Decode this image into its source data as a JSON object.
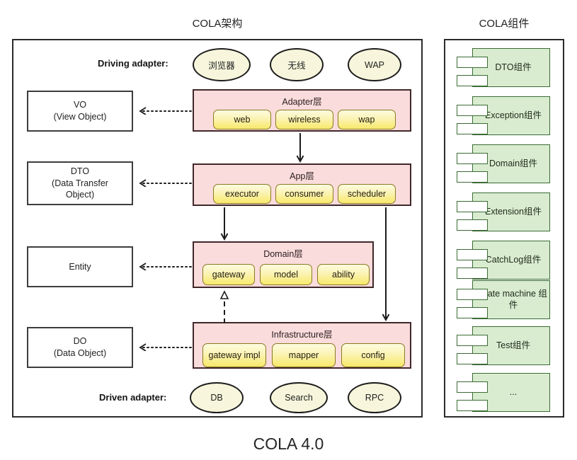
{
  "titles": {
    "architecture": "COLA架构",
    "components": "COLA组件",
    "caption": "COLA 4.0"
  },
  "row_labels": {
    "driving": "Driving adapter:",
    "driven": "Driven adapter:"
  },
  "driving_adapters": [
    "浏览器",
    "无线",
    "WAP"
  ],
  "driven_adapters": [
    "DB",
    "Search",
    "RPC"
  ],
  "left_objects": [
    {
      "line1": "VO",
      "line2": "(View Object)"
    },
    {
      "line1": "DTO",
      "line2": "(Data Transfer",
      "line3": "Object)"
    },
    {
      "line1": "Entity",
      "line2": ""
    },
    {
      "line1": "DO",
      "line2": "(Data Object)"
    }
  ],
  "layers": [
    {
      "title": "Adapter层",
      "chips": [
        "web",
        "wireless",
        "wap"
      ]
    },
    {
      "title": "App层",
      "chips": [
        "executor",
        "consumer",
        "scheduler"
      ]
    },
    {
      "title": "Domain层",
      "chips": [
        "gateway",
        "model",
        "ability"
      ]
    },
    {
      "title": "Infrastructure层",
      "chips": [
        "gateway impl",
        "mapper",
        "config"
      ]
    }
  ],
  "components": [
    "DTO组件",
    "Exception组件",
    "Domain组件",
    "Extension组件",
    "CatchLog组件",
    "State machine 组件",
    "Test组件",
    "..."
  ],
  "colors": {
    "layer_fill": "#fadcdc",
    "layer_border": "#41282a",
    "chip_border": "#8a7a22",
    "component_fill": "#d9ecd0",
    "component_border": "#3b6b34",
    "ellipse_fill": "#f7f6dc",
    "frame_border": "#2b2b2b"
  }
}
